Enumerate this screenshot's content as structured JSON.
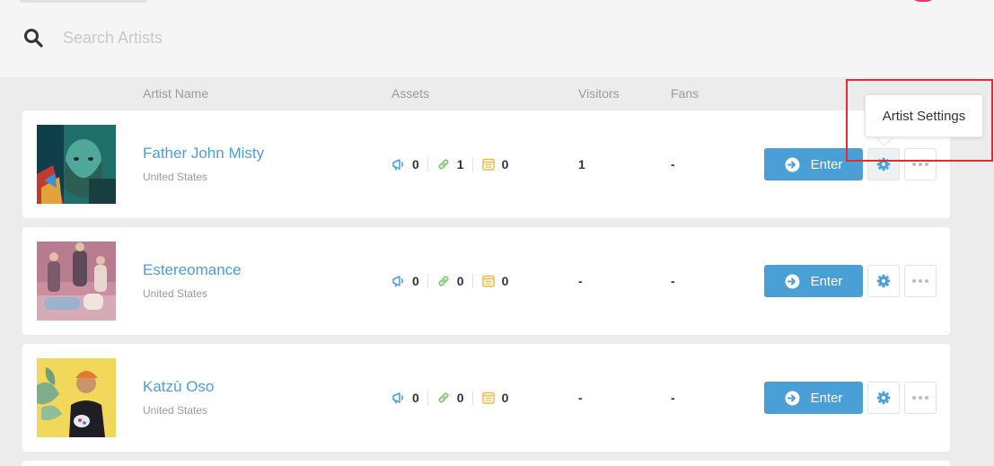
{
  "search": {
    "placeholder": "Search Artists",
    "value": ""
  },
  "columns": {
    "artist_name": "Artist Name",
    "assets": "Assets",
    "visitors": "Visitors",
    "fans": "Fans"
  },
  "tooltip": {
    "text": "Artist Settings"
  },
  "colors": {
    "accent": "#4a9fd6",
    "promo": "#4a9fd6",
    "link": "#7ec86e",
    "page": "#f5b942",
    "highlight": "#e02d2d"
  },
  "artists": [
    {
      "name": "Father John Misty",
      "country": "United States",
      "assets": {
        "promos": "0",
        "links": "1",
        "pages": "0"
      },
      "visitors": "1",
      "fans": "-",
      "enter_label": "Enter"
    },
    {
      "name": "Estereomance",
      "country": "United States",
      "assets": {
        "promos": "0",
        "links": "0",
        "pages": "0"
      },
      "visitors": "-",
      "fans": "-",
      "enter_label": "Enter"
    },
    {
      "name": "Katzù Oso",
      "country": "United States",
      "assets": {
        "promos": "0",
        "links": "0",
        "pages": "0"
      },
      "visitors": "-",
      "fans": "-",
      "enter_label": "Enter"
    }
  ]
}
